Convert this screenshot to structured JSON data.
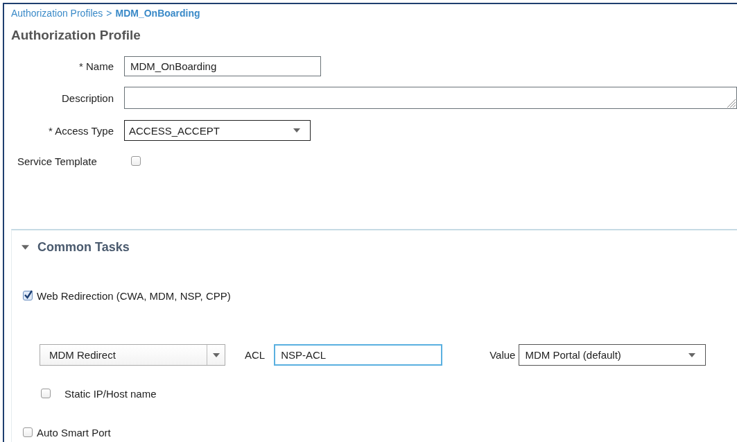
{
  "breadcrumb": {
    "parent": "Authorization Profiles",
    "separator": ">",
    "current": "MDM_OnBoarding"
  },
  "title": "Authorization Profile",
  "fields": [
    {
      "kind": "text",
      "label": "* Name",
      "value": "MDM_OnBoarding"
    },
    {
      "kind": "textarea",
      "label": "Description"
    },
    {
      "kind": "select",
      "label": "* Access Type",
      "value": "ACCESS_ACCEPT"
    },
    {
      "kind": "checkbox",
      "label": "Service Template",
      "checked": false
    }
  ],
  "common_tasks": {
    "title": "Common Tasks",
    "expanded": true,
    "web_redirection": {
      "label": "Web Redirection (CWA, MDM, NSP, CPP)",
      "checked": true,
      "redirect_type": "MDM Redirect",
      "acl_label": "ACL",
      "acl_value": "NSP-ACL",
      "value_label": "Value",
      "value": "MDM Portal (default)",
      "static_ip": {
        "label": "Static IP/Host name",
        "checked": false
      }
    },
    "auto_smart_port": {
      "label": "Auto Smart Port",
      "checked": false
    }
  }
}
